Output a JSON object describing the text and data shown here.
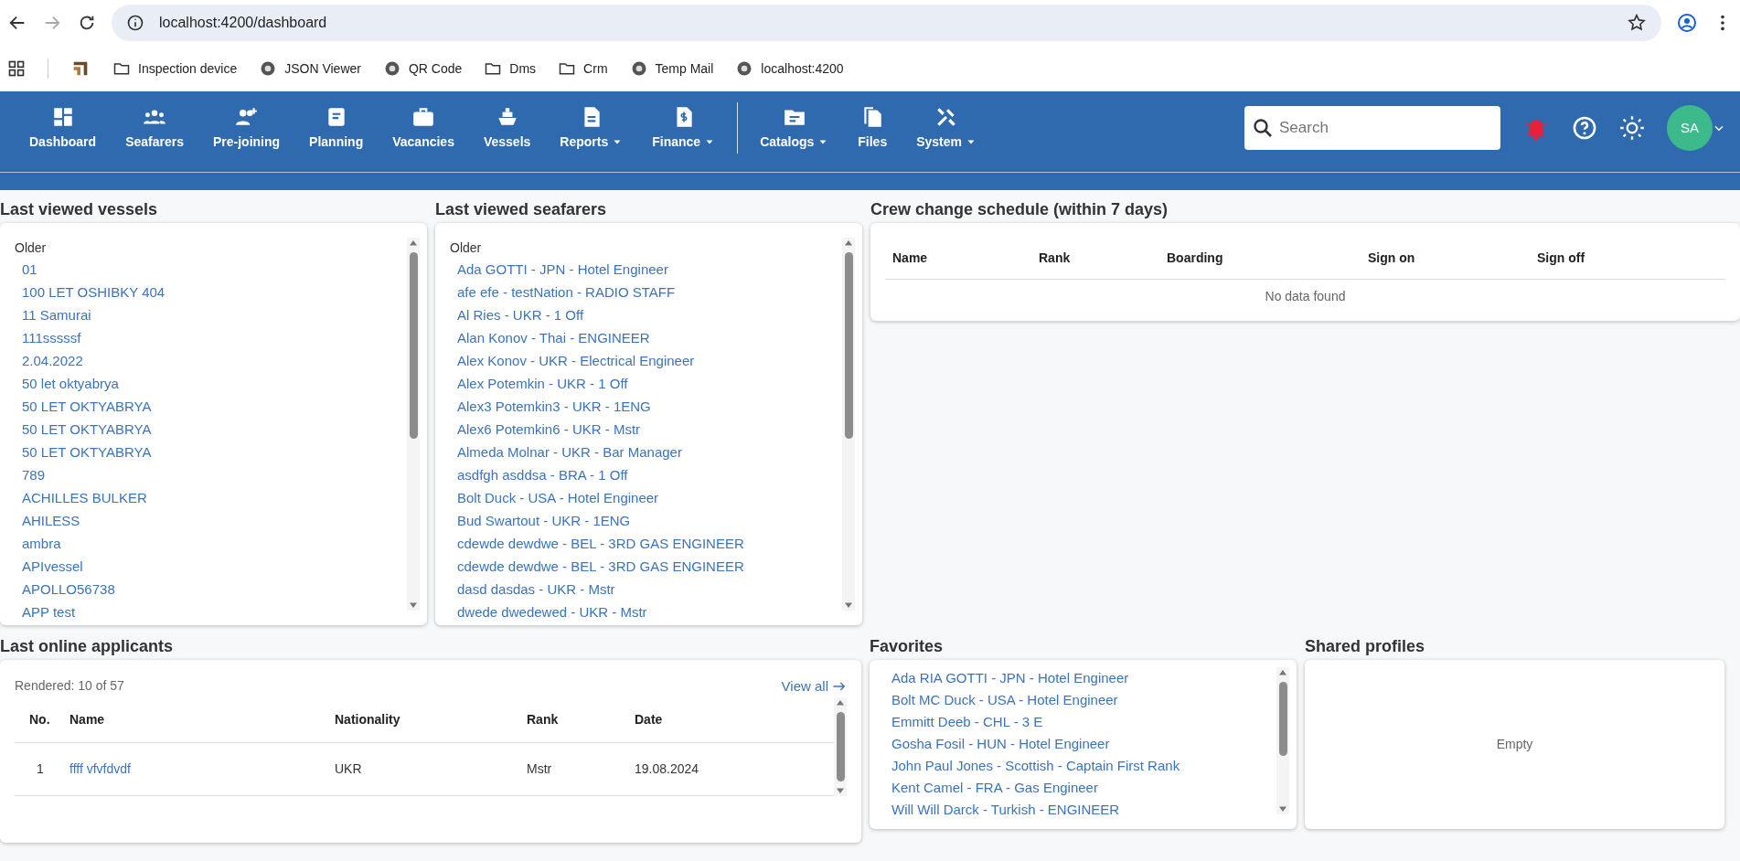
{
  "browser": {
    "address": "localhost:4200/dashboard",
    "bookmarks": [
      {
        "kind": "logo"
      },
      {
        "kind": "folder",
        "label": "Inspection device"
      },
      {
        "kind": "site",
        "label": "JSON Viewer"
      },
      {
        "kind": "site",
        "label": "QR Code"
      },
      {
        "kind": "folder",
        "label": "Dms"
      },
      {
        "kind": "folder",
        "label": "Crm"
      },
      {
        "kind": "site",
        "label": "Temp Mail"
      },
      {
        "kind": "site",
        "label": "localhost:4200"
      }
    ]
  },
  "nav": {
    "groups": [
      [
        {
          "label": "Dashboard",
          "dropdown": false
        },
        {
          "label": "Seafarers",
          "dropdown": false
        },
        {
          "label": "Pre-joining",
          "dropdown": false
        },
        {
          "label": "Planning",
          "dropdown": false
        },
        {
          "label": "Vacancies",
          "dropdown": false
        },
        {
          "label": "Vessels",
          "dropdown": false
        },
        {
          "label": "Reports",
          "dropdown": true
        },
        {
          "label": "Finance",
          "dropdown": true
        }
      ],
      [
        {
          "label": "Catalogs",
          "dropdown": true
        },
        {
          "label": "Files",
          "dropdown": false
        },
        {
          "label": "System",
          "dropdown": true
        }
      ]
    ],
    "search": {
      "placeholder": "Search"
    },
    "avatar": "SA"
  },
  "last_viewed_vessels": {
    "title": "Last viewed vessels",
    "group": "Older",
    "items": [
      "01",
      "100 LET OSHIBKY 404",
      "11 Samurai",
      "111sssssf",
      "2.04.2022",
      "50 let oktyabrya",
      "50 LET OKTYABRYA",
      "50 LET OKTYABRYA",
      "50 LET OKTYABRYA",
      "789",
      "ACHILLES BULKER",
      "AHILESS",
      "ambra",
      "APIvessel",
      "APOLLO56738",
      "APP test"
    ]
  },
  "last_viewed_seafarers": {
    "title": "Last viewed seafarers",
    "group": "Older",
    "items": [
      "Ada GOTTI - JPN - Hotel Engineer",
      "afe efe - testNation - RADIO STAFF",
      "Al Ries - UKR - 1 Off",
      "Alan Konov - Thai - ENGINEER",
      "Alex Konov - UKR - Electrical Engineer",
      "Alex Potemkin - UKR - 1 Off",
      "Alex3 Potemkin3 - UKR - 1ENG",
      "Alex6 Potemkin6 - UKR - Mstr",
      "Almeda Molnar - UKR - Bar Manager",
      "asdfgh asddsa - BRA - 1 Off",
      "Bolt Duck - USA - Hotel Engineer",
      "Bud Swartout - UKR - 1ENG",
      "cdewde dewdwe - BEL - 3RD GAS ENGINEER",
      "cdewde dewdwe - BEL - 3RD GAS ENGINEER",
      "dasd dasdas - UKR - Mstr",
      "dwede dwedewed - UKR - Mstr"
    ]
  },
  "crew_change_schedule": {
    "title": "Crew change schedule (within 7 days)",
    "columns": [
      "Name",
      "Rank",
      "Boarding",
      "Sign on",
      "Sign off"
    ],
    "empty": "No data found"
  },
  "last_online_applicants": {
    "title": "Last online applicants",
    "rendered": "Rendered: 10 of 57",
    "view_all": "View all",
    "columns": [
      "No.",
      "Name",
      "Nationality",
      "Rank",
      "Date"
    ],
    "rows": [
      {
        "no": "1",
        "name": "ffff vfvfdvdf",
        "nationality": "UKR",
        "rank": "Mstr",
        "date": "19.08.2024"
      }
    ]
  },
  "favorites": {
    "title": "Favorites",
    "items": [
      "Ada RIA GOTTI - JPN - Hotel Engineer",
      "Bolt MC Duck - USA - Hotel Engineer",
      "Emmitt Deeb - CHL - 3 E",
      "Gosha Fosil - HUN - Hotel Engineer",
      "John Paul Jones - Scottish - Captain First Rank",
      "Kent Camel - FRA - Gas Engineer",
      "Will Will Darck - Turkish - ENGINEER"
    ]
  },
  "shared_profiles": {
    "title": "Shared profiles",
    "empty": "Empty"
  }
}
